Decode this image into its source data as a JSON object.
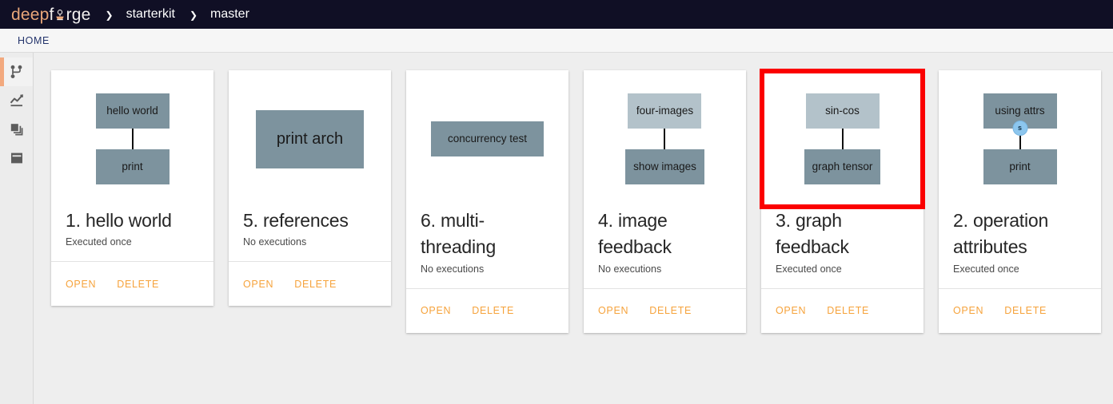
{
  "navbar": {
    "logo": {
      "part1": "deep",
      "part2": "f",
      "part3": "rge",
      "icon": "anvil-icon"
    },
    "separator": "❯",
    "breadcrumbs": [
      {
        "label": "starterkit"
      },
      {
        "label": "master"
      }
    ]
  },
  "tabs": [
    {
      "label": "HOME",
      "active": true
    }
  ],
  "sidebar": {
    "items": [
      {
        "name": "pipelines",
        "icon": "branch-icon",
        "active": true
      },
      {
        "name": "executions",
        "icon": "line-chart-icon",
        "active": false
      },
      {
        "name": "artifacts",
        "icon": "layers-icon",
        "active": false
      },
      {
        "name": "archive",
        "icon": "archive-box-icon",
        "active": false
      }
    ]
  },
  "cards": [
    {
      "title": "1. hello world",
      "subtitle": "Executed once",
      "open_label": "OPEN",
      "delete_label": "DELETE",
      "highlighted": false,
      "nodes": [
        {
          "label": "hello world",
          "kind": "op",
          "size": "normal"
        },
        {
          "label": "print",
          "kind": "op",
          "size": "normal"
        }
      ],
      "connector": true,
      "badge": null
    },
    {
      "title": "5. references",
      "subtitle": "No executions",
      "open_label": "OPEN",
      "delete_label": "DELETE",
      "highlighted": false,
      "nodes": [
        {
          "label": "print arch",
          "kind": "op",
          "size": "big"
        }
      ],
      "connector": false,
      "badge": null
    },
    {
      "title": "6. multi-threading",
      "subtitle": "No executions",
      "open_label": "OPEN",
      "delete_label": "DELETE",
      "highlighted": false,
      "nodes": [
        {
          "label": "concurrency test",
          "kind": "op",
          "size": "wide"
        }
      ],
      "connector": false,
      "badge": null
    },
    {
      "title": "4. image feedback",
      "subtitle": "No executions",
      "open_label": "OPEN",
      "delete_label": "DELETE",
      "highlighted": false,
      "nodes": [
        {
          "label": "four-images",
          "kind": "data",
          "size": "normal"
        },
        {
          "label": "show images",
          "kind": "op",
          "size": "normal"
        }
      ],
      "connector": true,
      "badge": null
    },
    {
      "title": "3. graph feedback",
      "subtitle": "Executed once",
      "open_label": "OPEN",
      "delete_label": "DELETE",
      "highlighted": true,
      "nodes": [
        {
          "label": "sin-cos",
          "kind": "data",
          "size": "normal"
        },
        {
          "label": "graph tensor",
          "kind": "op",
          "size": "normal"
        }
      ],
      "connector": true,
      "badge": null
    },
    {
      "title": "2. operation attributes",
      "subtitle": "Executed once",
      "open_label": "OPEN",
      "delete_label": "DELETE",
      "highlighted": false,
      "nodes": [
        {
          "label": "using attrs",
          "kind": "op",
          "size": "normal"
        },
        {
          "label": "print",
          "kind": "op",
          "size": "normal"
        }
      ],
      "connector": true,
      "badge": "s"
    }
  ],
  "colors": {
    "navbar_bg": "#100f25",
    "logo_accent": "#e8a679",
    "page_bg": "#eeeeee",
    "card_bg": "#ffffff",
    "node_op": "#7d939e",
    "node_data": "#b3c2ca",
    "action_orange": "#f6a33c",
    "highlight_red": "#fb0000",
    "tab_text": "#23346b",
    "badge_blue": "#8cc6ee",
    "sidebar_active": "#f2a97e"
  }
}
